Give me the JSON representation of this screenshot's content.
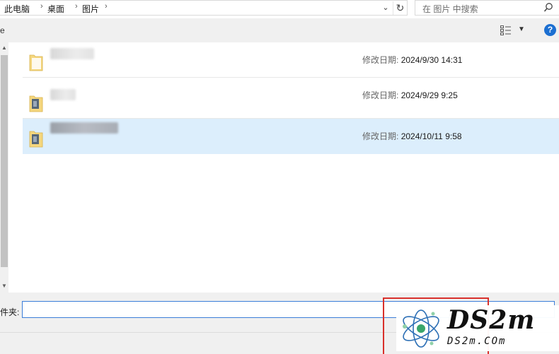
{
  "address": {
    "breadcrumbs": [
      "此电脑",
      "桌面",
      "图片"
    ],
    "search_placeholder": "在 图片 中搜索"
  },
  "toolbar": {
    "left_label": "e",
    "help_label": "?"
  },
  "files": [
    {
      "modified_label": "修改日期:",
      "modified_value": "2024/9/30 14:31",
      "selected": false
    },
    {
      "modified_label": "修改日期:",
      "modified_value": "2024/9/29 9:25",
      "selected": false
    },
    {
      "modified_label": "修改日期:",
      "modified_value": "2024/10/11 9:58",
      "selected": true
    }
  ],
  "bottom": {
    "folder_label": "件夹:",
    "folder_value": ""
  },
  "watermark": {
    "title": "DS2m",
    "subtitle": "DS2m.COm"
  },
  "colors": {
    "selection": "#dceefc",
    "help_blue": "#1c6fd1",
    "input_border": "#3b7dd8",
    "highlight_red": "#d9302b"
  }
}
